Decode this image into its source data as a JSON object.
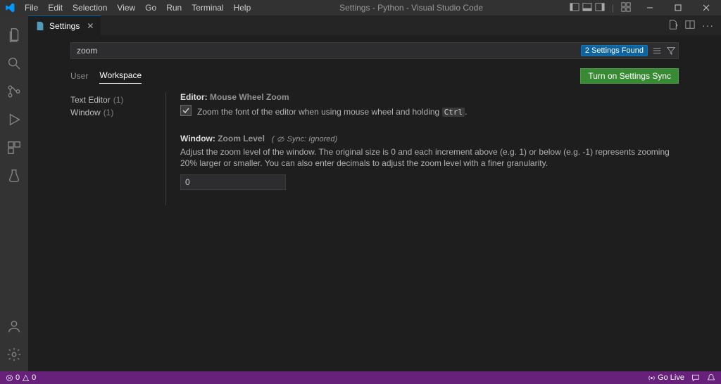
{
  "window_title": "Settings - Python - Visual Studio Code",
  "menu": [
    "File",
    "Edit",
    "Selection",
    "View",
    "Go",
    "Run",
    "Terminal",
    "Help"
  ],
  "tab": {
    "label": "Settings"
  },
  "search": {
    "value": "zoom",
    "badge": "2 Settings Found"
  },
  "scope": {
    "user": "User",
    "workspace": "Workspace"
  },
  "sync_button": "Turn on Settings Sync",
  "tree": [
    {
      "label": "Text Editor",
      "count": "(1)"
    },
    {
      "label": "Window",
      "count": "(1)"
    }
  ],
  "setting1": {
    "category": "Editor:",
    "name": "Mouse Wheel Zoom",
    "desc_before": "Zoom the font of the editor when using mouse wheel and holding ",
    "key": "Ctrl",
    "desc_after": "."
  },
  "setting2": {
    "category": "Window:",
    "name": "Zoom Level",
    "sync_meta_open": "(",
    "sync_meta": "Sync: Ignored)",
    "desc": "Adjust the zoom level of the window. The original size is 0 and each increment above (e.g. 1) or below (e.g. -1) represents zooming 20% larger or smaller. You can also enter decimals to adjust the zoom level with a finer granularity.",
    "value": "0"
  },
  "status": {
    "errors": "0",
    "warnings": "0",
    "golive": "Go Live"
  }
}
